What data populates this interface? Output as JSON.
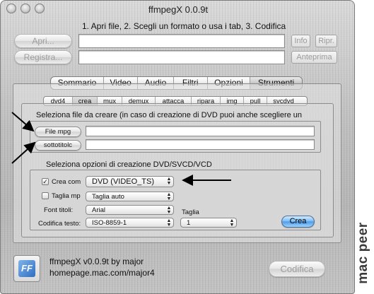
{
  "window": {
    "title": "ffmpegX 0.0.9t"
  },
  "header": {
    "instruction": "1. Apri file, 2. Scegli un formato o usa i tab, 3. Codifica",
    "open_button": "Apri...",
    "save_button": "Registra...",
    "info_button": "Info",
    "play_button": "Ripr.",
    "preview_button": "Anteprima",
    "source_path": "",
    "dest_path": ""
  },
  "main_tabs": [
    {
      "label": "Sommario",
      "active": false
    },
    {
      "label": "Video",
      "active": false
    },
    {
      "label": "Audio",
      "active": false
    },
    {
      "label": "Filtri",
      "active": false
    },
    {
      "label": "Opzioni",
      "active": false
    },
    {
      "label": "Strumenti",
      "active": true
    }
  ],
  "sub_tabs": [
    {
      "label": "dvd4",
      "active": false
    },
    {
      "label": "crea",
      "active": true
    },
    {
      "label": "mux",
      "active": false
    },
    {
      "label": "demux",
      "active": false
    },
    {
      "label": "attacca",
      "active": false
    },
    {
      "label": "ripara",
      "active": false
    },
    {
      "label": "img",
      "active": false
    },
    {
      "label": "pull",
      "active": false
    },
    {
      "label": "svcdvd",
      "active": false
    }
  ],
  "file_section": {
    "heading": "Seleziona file da creare (in caso di creazione di DVD puoi anche scegliere un",
    "mpg_button": "File mpg",
    "subtitle_button": "sottotitolc",
    "mpg_path": "",
    "subtitle_path": ""
  },
  "options_section": {
    "heading": "Seleziona opzioni di creazione DVD/SVCD/VCD",
    "create_label": "Crea com",
    "create_checked": true,
    "create_value": "DVD (VIDEO_TS)",
    "cut_label": "Taglia mp",
    "cut_checked": false,
    "cut_value": "Taglia auto",
    "font_label": "Font titoli:",
    "font_value": "Arial",
    "encoding_label": "Codifica testo:",
    "encoding_value": "ISO-8859-1",
    "size_label": "Taglia",
    "size_value": "1",
    "create_button": "Crea"
  },
  "footer": {
    "about_line1": "ffmpegX v0.0.9t by major",
    "about_line2": "homepage.mac.com/major4",
    "encode_button": "Codifica",
    "logo_letters": "FF"
  },
  "watermark": "mac peer",
  "colors": {
    "arrow": "#000000",
    "default_button": "#4f9de9",
    "window_metal": "#c0c0c0"
  }
}
